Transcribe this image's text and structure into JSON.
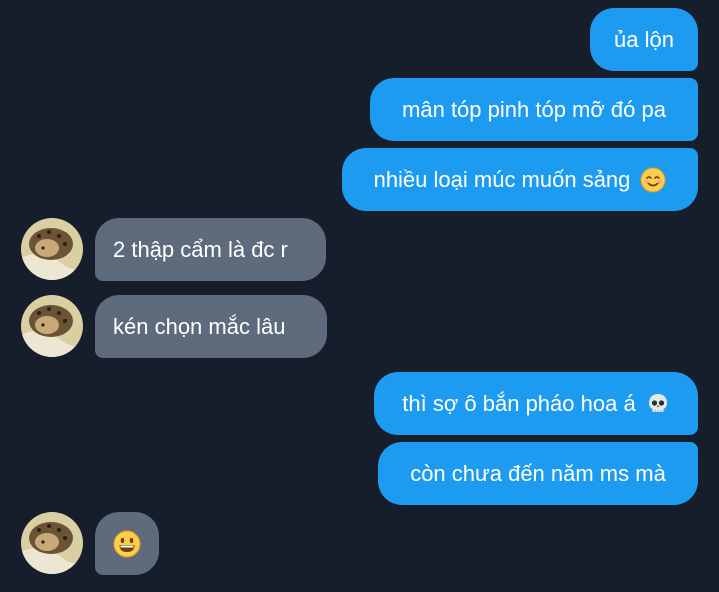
{
  "messages": [
    {
      "dir": "out",
      "text": "ủa lộn"
    },
    {
      "dir": "out",
      "text": "mân tóp pinh tóp mỡ đó pa"
    },
    {
      "dir": "out",
      "text": "nhiều loại múc muốn sảng",
      "emoji": "warm-smile-emoji"
    },
    {
      "dir": "in",
      "text": "2 thập cẩm là đc r"
    },
    {
      "dir": "in",
      "text": "kén chọn mắc lâu"
    },
    {
      "dir": "out",
      "text": "thì sợ ô bắn pháo hoa á",
      "emoji": "skull-emoji"
    },
    {
      "dir": "out",
      "text": "còn chưa đến năm ms mà"
    },
    {
      "dir": "in",
      "text": "",
      "emoji": "grinning-face-emoji"
    }
  ],
  "colors": {
    "background": "#161e2b",
    "outgoing_bubble": "#1d9bf0",
    "incoming_bubble": "#5d6b7c",
    "text": "#ffffff"
  }
}
